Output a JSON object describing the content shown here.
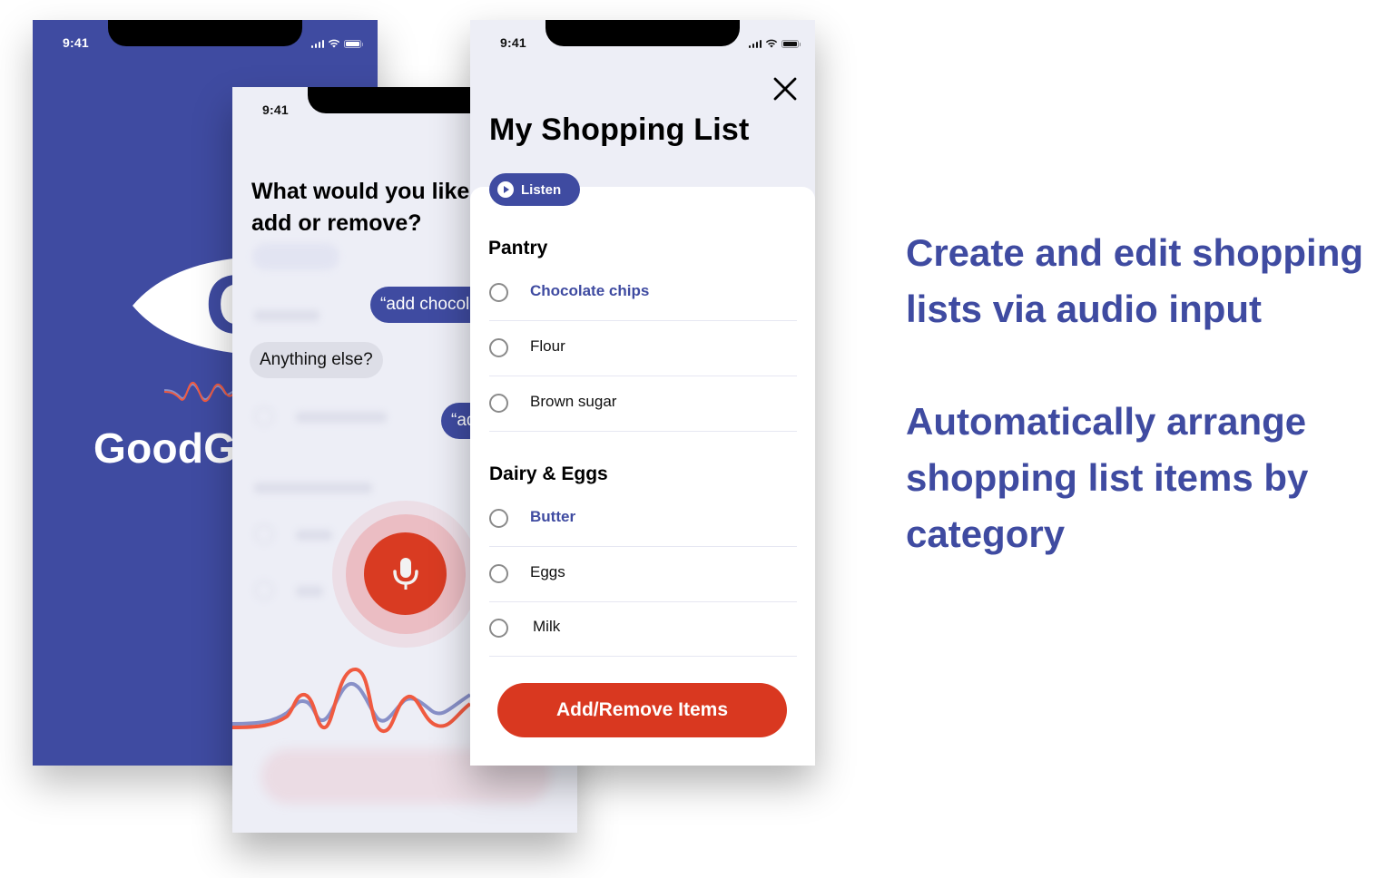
{
  "status_bar": {
    "time": "9:41"
  },
  "colors": {
    "brand_blue": "#3f4ba1",
    "accent_red": "#d93820",
    "wave_blue": "#8890c8",
    "wave_red": "#f05a40",
    "screen_bg": "#edeef6"
  },
  "splash": {
    "logo_letter": "G",
    "brand_name": "GoodGuide"
  },
  "voice": {
    "question": "What would you like to add or remove?",
    "question_visible_lines": [
      "What would you like",
      "add or remove?"
    ],
    "bubbles": [
      {
        "role": "user",
        "text": "“add chocolate chips”"
      },
      {
        "role": "assistant",
        "text": "Anything else?"
      },
      {
        "role": "user",
        "text": "“add butter”"
      }
    ],
    "mic_icon": "microphone-icon"
  },
  "list": {
    "close_icon": "close-icon",
    "title": "My Shopping List",
    "listen_label": "Listen",
    "listen_icon": "play-circle-icon",
    "categories": [
      {
        "name": "Pantry",
        "items": [
          {
            "name": "Chocolate chips",
            "highlighted": true,
            "checked": false
          },
          {
            "name": "Flour",
            "highlighted": false,
            "checked": false
          },
          {
            "name": "Brown sugar",
            "highlighted": false,
            "checked": false
          }
        ]
      },
      {
        "name": "Dairy & Eggs",
        "items": [
          {
            "name": "Butter",
            "highlighted": true,
            "checked": false
          },
          {
            "name": "Eggs",
            "highlighted": false,
            "checked": false
          },
          {
            "name": "Milk",
            "highlighted": false,
            "checked": false
          }
        ]
      }
    ],
    "primary_button": "Add/Remove Items"
  },
  "features": [
    "Create and edit shopping lists via audio input",
    "Automatically arrange shopping list items by category"
  ],
  "features_lines": [
    [
      "Create and edit shopping",
      "lists via audio input"
    ],
    [
      "Automatically arrange",
      "shopping list items by",
      "category"
    ]
  ]
}
